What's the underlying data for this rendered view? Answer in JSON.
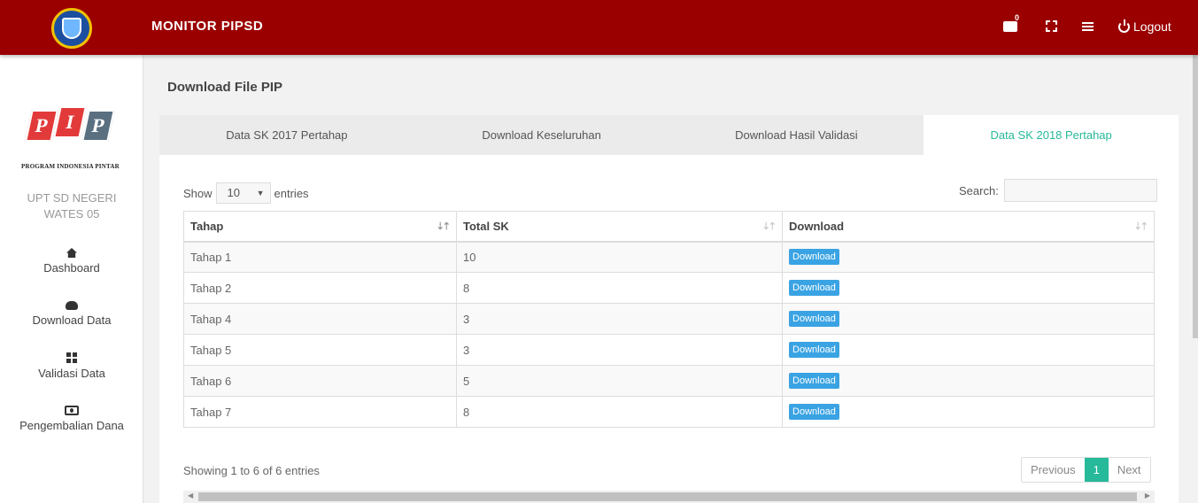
{
  "header": {
    "brand": "MONITOR PIPSD",
    "mail_count": "0",
    "logout_label": "Logout"
  },
  "sidebar": {
    "logo_letters": [
      "P",
      "I",
      "P"
    ],
    "logo_caption": "PROGRAM INDONESIA PINTAR",
    "school_line1": "UPT SD NEGERI",
    "school_line2": "WATES 05",
    "items": [
      {
        "label": "Dashboard",
        "icon": "home-icon"
      },
      {
        "label": "Download Data",
        "icon": "cloud-download-icon"
      },
      {
        "label": "Validasi Data",
        "icon": "grid-icon"
      },
      {
        "label": "Pengembalian Dana",
        "icon": "money-icon"
      }
    ]
  },
  "main": {
    "title": "Download File PIP",
    "tabs": [
      {
        "label": "Data SK 2017 Pertahap"
      },
      {
        "label": "Download Keseluruhan"
      },
      {
        "label": "Download Hasil Validasi"
      },
      {
        "label": "Data SK 2018 Pertahap"
      }
    ],
    "show_label": "Show",
    "entries_value": "10",
    "entries_label": "entries",
    "search_label": "Search:",
    "table": {
      "headers": [
        "Tahap",
        "Total SK",
        "Download"
      ],
      "rows": [
        {
          "tahap": "Tahap 1",
          "total": "10",
          "button": "Download"
        },
        {
          "tahap": "Tahap 2",
          "total": "8",
          "button": "Download"
        },
        {
          "tahap": "Tahap 4",
          "total": "3",
          "button": "Download"
        },
        {
          "tahap": "Tahap 5",
          "total": "3",
          "button": "Download"
        },
        {
          "tahap": "Tahap 6",
          "total": "5",
          "button": "Download"
        },
        {
          "tahap": "Tahap 7",
          "total": "8",
          "button": "Download"
        }
      ]
    },
    "info": "Showing 1 to 6 of 6 entries",
    "pager": {
      "previous": "Previous",
      "current": "1",
      "next": "Next"
    }
  },
  "colors": {
    "header_bg": "#9b0000",
    "accent_green": "#26b99a",
    "button_blue": "#3aa3e3"
  }
}
